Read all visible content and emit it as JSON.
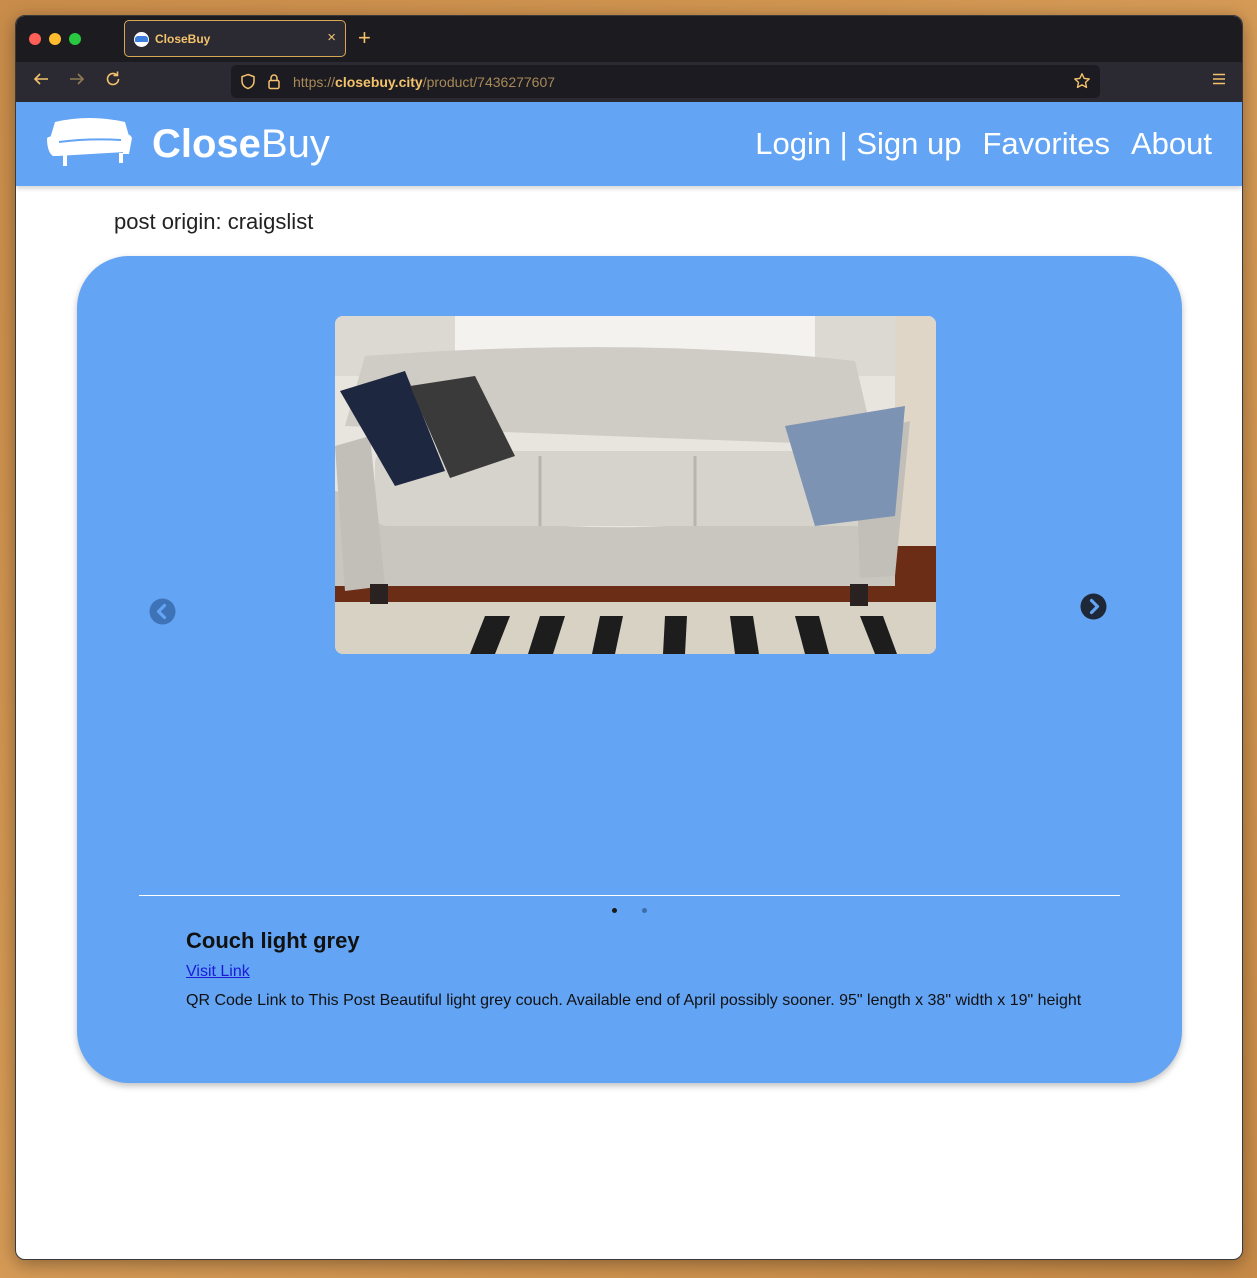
{
  "browser": {
    "tab_title": "CloseBuy",
    "tab_close": "×",
    "new_tab": "+",
    "url_prefix": "https://",
    "url_domain": "closebuy.city",
    "url_path": "/product/7436277607"
  },
  "site": {
    "brand_bold": "Close",
    "brand_light": "Buy",
    "nav": {
      "login": "Login | Sign up",
      "favorites": "Favorites",
      "about": "About"
    },
    "accent_color": "#63a4f4"
  },
  "post": {
    "origin": "post origin: craigslist",
    "title": "Couch light grey",
    "link_label": "Visit Link",
    "description": "QR Code Link to This Post Beautiful light grey couch. Available end of April possibly sooner. 95\" length x 38\" width x 19\" height"
  },
  "carousel": {
    "image_icon": "couch-photo",
    "prev_icon": "chevron-left-circle-icon",
    "next_icon": "chevron-right-circle-icon",
    "slide_count": 2,
    "active_slide": 1
  }
}
